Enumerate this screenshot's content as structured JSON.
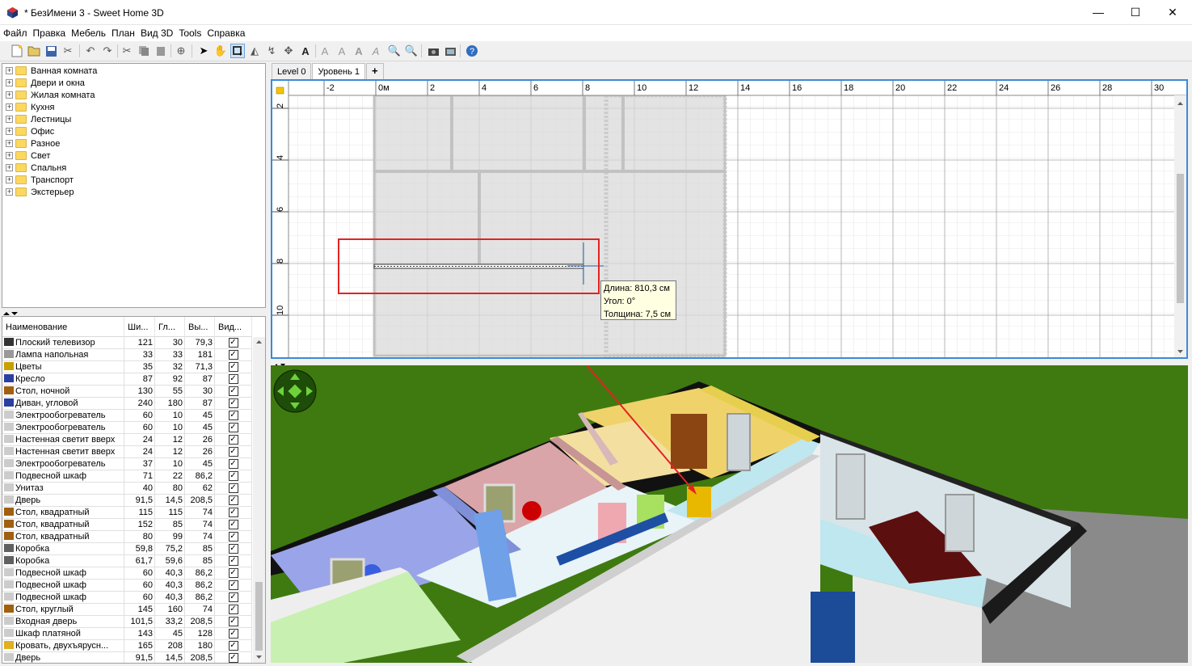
{
  "window": {
    "title": "* БезИмени 3 - Sweet Home 3D",
    "minimize": "—",
    "maximize": "☐",
    "close": "✕"
  },
  "menu": [
    "Файл",
    "Правка",
    "Мебель",
    "План",
    "Вид 3D",
    "Tools",
    "Справка"
  ],
  "toolbar": [
    "new-icon",
    "open-icon",
    "save-icon",
    "cut-preferences-icon",
    "undo-icon",
    "redo-icon",
    "cut-icon",
    "copy-icon",
    "paste-icon",
    "add-furniture-icon",
    "select-icon",
    "pan-icon",
    "create-walls-icon",
    "create-rooms-icon",
    "create-polylines-icon",
    "create-dimensions-icon",
    "add-text-icon",
    "text-style-icons",
    "zoom-in-icon",
    "zoom-out-icon",
    "photo-icon",
    "video-icon",
    "help-icon"
  ],
  "catalog": [
    "Ванная комната",
    "Двери и окна",
    "Жилая комната",
    "Кухня",
    "Лестницы",
    "Офис",
    "Разное",
    "Свет",
    "Спальня",
    "Транспорт",
    "Экстерьер"
  ],
  "furniture": {
    "headers": [
      "Наименование",
      "Ши...",
      "Гл...",
      "Вы...",
      "Вид..."
    ],
    "rows": [
      [
        "Плоский телевизор",
        "121",
        "30",
        "79,3"
      ],
      [
        "Лампа напольная",
        "33",
        "33",
        "181"
      ],
      [
        "Цветы",
        "35",
        "32",
        "71,3"
      ],
      [
        "Кресло",
        "87",
        "92",
        "87"
      ],
      [
        "Стол, ночной",
        "130",
        "55",
        "30"
      ],
      [
        "Диван, угловой",
        "240",
        "180",
        "87"
      ],
      [
        "Электрообогреватель",
        "60",
        "10",
        "45"
      ],
      [
        "Электрообогреватель",
        "60",
        "10",
        "45"
      ],
      [
        "Настенная светит вверх",
        "24",
        "12",
        "26"
      ],
      [
        "Настенная светит вверх",
        "24",
        "12",
        "26"
      ],
      [
        "Электрообогреватель",
        "37",
        "10",
        "45"
      ],
      [
        "Подвесной шкаф",
        "71",
        "22",
        "86,2"
      ],
      [
        "Унитаз",
        "40",
        "80",
        "62"
      ],
      [
        "Дверь",
        "91,5",
        "14,5",
        "208,5"
      ],
      [
        "Стол, квадратный",
        "115",
        "115",
        "74"
      ],
      [
        "Стол, квадратный",
        "152",
        "85",
        "74"
      ],
      [
        "Стол, квадратный",
        "80",
        "99",
        "74"
      ],
      [
        "Коробка",
        "59,8",
        "75,2",
        "85"
      ],
      [
        "Коробка",
        "61,7",
        "59,6",
        "85"
      ],
      [
        "Подвесной шкаф",
        "60",
        "40,3",
        "86,2"
      ],
      [
        "Подвесной шкаф",
        "60",
        "40,3",
        "86,2"
      ],
      [
        "Подвесной шкаф",
        "60",
        "40,3",
        "86,2"
      ],
      [
        "Стол, круглый",
        "145",
        "160",
        "74"
      ],
      [
        "Входная дверь",
        "101,5",
        "33,2",
        "208,5"
      ],
      [
        "Шкаф платяной",
        "143",
        "45",
        "128"
      ],
      [
        "Кровать, двухъярусн...",
        "165",
        "208",
        "180"
      ],
      [
        "Дверь",
        "91,5",
        "14,5",
        "208,5"
      ]
    ]
  },
  "tabs": {
    "level0": "Level 0",
    "level1": "Уровень 1",
    "add": "+"
  },
  "ruler": {
    "h": [
      "-2",
      "0м",
      "2",
      "4",
      "6",
      "8",
      "10",
      "12",
      "14",
      "16",
      "18",
      "20",
      "22",
      "24",
      "26",
      "28",
      "30"
    ],
    "v": [
      "2",
      "4",
      "6",
      "8",
      "10"
    ]
  },
  "tooltip": {
    "length": "Длина: 810,3 см",
    "angle": "Угол: 0°",
    "thickness": "Толщина: 7,5 см"
  }
}
